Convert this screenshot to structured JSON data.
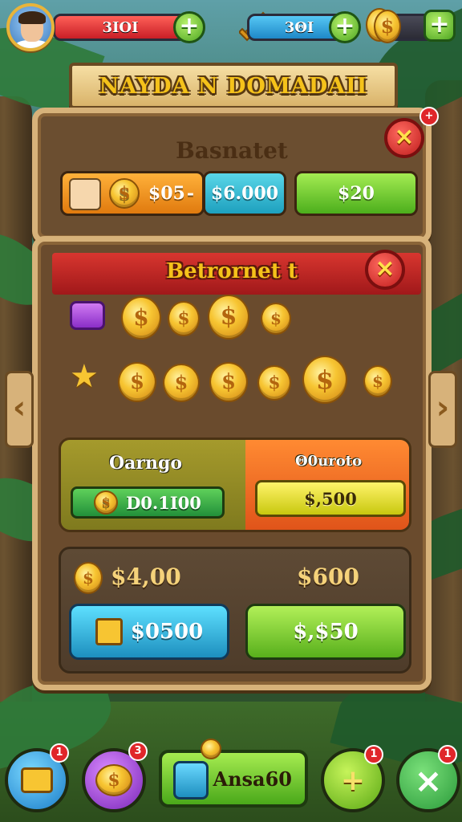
{
  "hud": {
    "health_value": "3ΙΟΙ",
    "gems_value": "3ΘΙ",
    "extra_value": ""
  },
  "banner": {
    "title": "NAYDA N DOMADAII"
  },
  "back_panel": {
    "title": "Basnatet",
    "orange_value": "$05",
    "orange_suffix": "-",
    "cyan_value": "$6.000",
    "green_value": "$20"
  },
  "front_panel": {
    "title": "Betrornet t",
    "card1": {
      "left_label": "Oarngo",
      "left_button": "D0.1Ι00",
      "right_label": "Θ0uroto",
      "right_button": "$,500"
    },
    "card2": {
      "left_price": "$4,00",
      "right_price": "$600",
      "left_button": "$0500",
      "right_button": "$,$50"
    }
  },
  "bottom_nav": {
    "badge_chest": "1",
    "badge_coins": "3",
    "badge_center": "",
    "center_label": "Ansa60",
    "badge_plus": "1",
    "badge_close": "1"
  },
  "icons": {
    "coin": "$",
    "plus": "+",
    "close": "×",
    "arrow_left": "‹",
    "arrow_right": "›",
    "star": "★"
  },
  "colors": {
    "accent_gold": "#f5c21a",
    "panel_wood": "#6b4e30",
    "frame": "#d7b27a",
    "red_ribbon": "#c81e26",
    "green_button": "#4cae1c"
  }
}
